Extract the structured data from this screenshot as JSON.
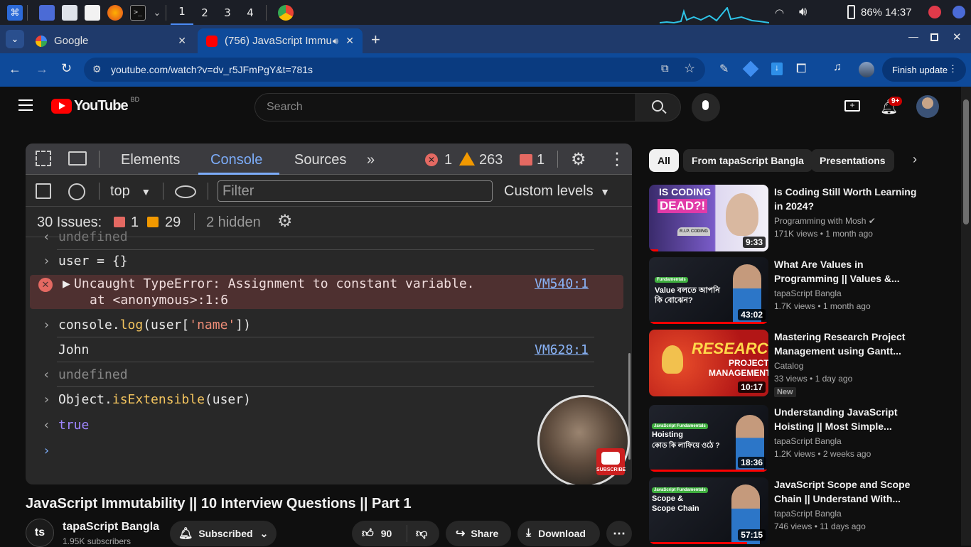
{
  "taskbar": {
    "workspaces": [
      "1",
      "2",
      "3",
      "4"
    ],
    "battery": "86%",
    "clock": "14:37"
  },
  "browser": {
    "tabs": [
      {
        "label": "Google"
      },
      {
        "label": "(756) JavaScript Immu"
      }
    ],
    "url": "youtube.com/watch?v=dv_r5JFmPgY&t=781s",
    "finish_update": "Finish update"
  },
  "youtube": {
    "logo_text": "YouTube",
    "region": "BD",
    "search_placeholder": "Search",
    "notifications_badge": "9+"
  },
  "devtools": {
    "tabs": [
      "Elements",
      "Console",
      "Sources"
    ],
    "error_count": "1",
    "warning_count": "263",
    "issue_count": "1",
    "context": "top",
    "filter_placeholder": "Filter",
    "levels": "Custom levels",
    "issues_label": "30 Issues:",
    "issues_errors": "1",
    "issues_warnings": "29",
    "hidden": "2 hidden",
    "console": {
      "line0": "undefined",
      "line1": "user = {}",
      "error_main": "Uncaught TypeError: Assignment to constant variable.",
      "error_sub": "at <anonymous>:1:6",
      "error_link": "VM540:1",
      "line3_a": "console.",
      "line3_b": "log",
      "line3_c": "(user[",
      "line3_d": "'name'",
      "line3_e": "])",
      "output_john": "John",
      "john_link": "VM628:1",
      "line5": "undefined",
      "line6_a": "Object.",
      "line6_b": "isExtensible",
      "line6_c": "(user)",
      "line7": "true"
    },
    "webcam_badge": "SUBSCRIBE"
  },
  "video": {
    "title": "JavaScript Immutability || 10 Interview Questions || Part 1",
    "channel": "tapaScript Bangla",
    "subscribers": "1.95K subscribers",
    "subscribed": "Subscribed",
    "likes": "90",
    "share": "Share",
    "download": "Download"
  },
  "sidebar": {
    "chips": [
      "All",
      "From tapaScript Bangla",
      "Presentations"
    ],
    "items": [
      {
        "title": "Is Coding Still Worth Learning in 2024?",
        "channel": "Programming with Mosh",
        "views": "171K views",
        "age": "1 month ago",
        "duration": "9:33",
        "thumb_text_1": "IS CODING",
        "thumb_text_2": "DEAD?!",
        "thumb_text_3": "R.I.P. CODING"
      },
      {
        "title": "What Are Values in Programming || Values &...",
        "channel": "tapaScript Bangla",
        "views": "1.7K views",
        "age": "1 month ago",
        "duration": "43:02",
        "thumb_text_1": "Fundamentals",
        "thumb_text_2": "Value বলতে আপনি",
        "thumb_text_3": "কি বোঝেন?"
      },
      {
        "title": "Mastering Research Project Management using Gantt...",
        "channel": "Catalog",
        "views": "33 views",
        "age": "1 day ago",
        "duration": "10:17",
        "badge": "New",
        "thumb_text_1": "RESEARCH",
        "thumb_text_2": "PROJECT",
        "thumb_text_3": "MANAGEMENT"
      },
      {
        "title": "Understanding JavaScript Hoisting || Most Simple...",
        "channel": "tapaScript Bangla",
        "views": "1.2K views",
        "age": "2 weeks ago",
        "duration": "18:36",
        "thumb_text_1": "JavaScript Fundamentals",
        "thumb_text_2": "Hoisting",
        "thumb_text_3": "কোড কি লাফিয়ে ওঠে ?"
      },
      {
        "title": "JavaScript Scope and Scope Chain || Understand With...",
        "channel": "tapaScript Bangla",
        "views": "746 views",
        "age": "11 days ago",
        "duration": "57:15",
        "thumb_text_1": "JavaScript Fundamentals",
        "thumb_text_2": "Scope &",
        "thumb_text_3": "Scope Chain"
      }
    ]
  },
  "colors": {
    "yt_red": "#ff0000",
    "chrome_blue": "#0e4a9a",
    "devtools_accent": "#7cacf8",
    "error_red": "#e46962"
  }
}
